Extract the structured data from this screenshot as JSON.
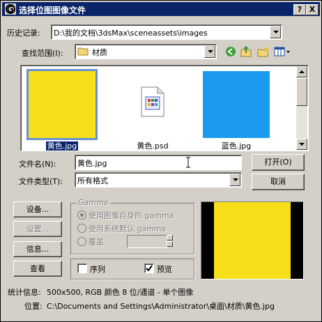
{
  "window": {
    "title": "选择位图图像文件",
    "help_label": "?",
    "close_label": "X"
  },
  "history": {
    "label": "历史记录:",
    "value": "D:\\我的文档\\3dsMax\\sceneassets\\images"
  },
  "lookin": {
    "label": "查找范围(I):",
    "value": "材质"
  },
  "files": [
    {
      "name": "黄色.jpg",
      "kind": "image",
      "color": "#f7e01b",
      "selected": true
    },
    {
      "name": "黄色.psd",
      "kind": "doc-icon",
      "selected": false
    },
    {
      "name": "蓝色.jpg",
      "kind": "image",
      "color": "#1a9bf0",
      "selected": false
    }
  ],
  "filename": {
    "label": "文件名(N):",
    "value": "黄色.jpg"
  },
  "filetype": {
    "label": "文件类型(T):",
    "value": "所有格式"
  },
  "buttons": {
    "open": "打开(O)",
    "cancel": "取消",
    "setup": "设备...",
    "settings": "设置...",
    "info": "信息...",
    "view": "查看"
  },
  "gamma": {
    "title": "Gamma",
    "opt1": "使用图像自身的 gamma",
    "opt2": "使用系统默认 gamma",
    "opt3": "覆盖"
  },
  "options": {
    "sequence": "序列",
    "preview": "预览"
  },
  "preview_color": "#f7e01b",
  "stats": {
    "label": "统计信息:",
    "value": "500x500, RGB 颜色 8 位/通道 - 单个图像"
  },
  "location": {
    "label": "位置:",
    "value": "C:\\Documents and Settings\\Administrator\\桌面\\材质\\黄色.jpg"
  }
}
